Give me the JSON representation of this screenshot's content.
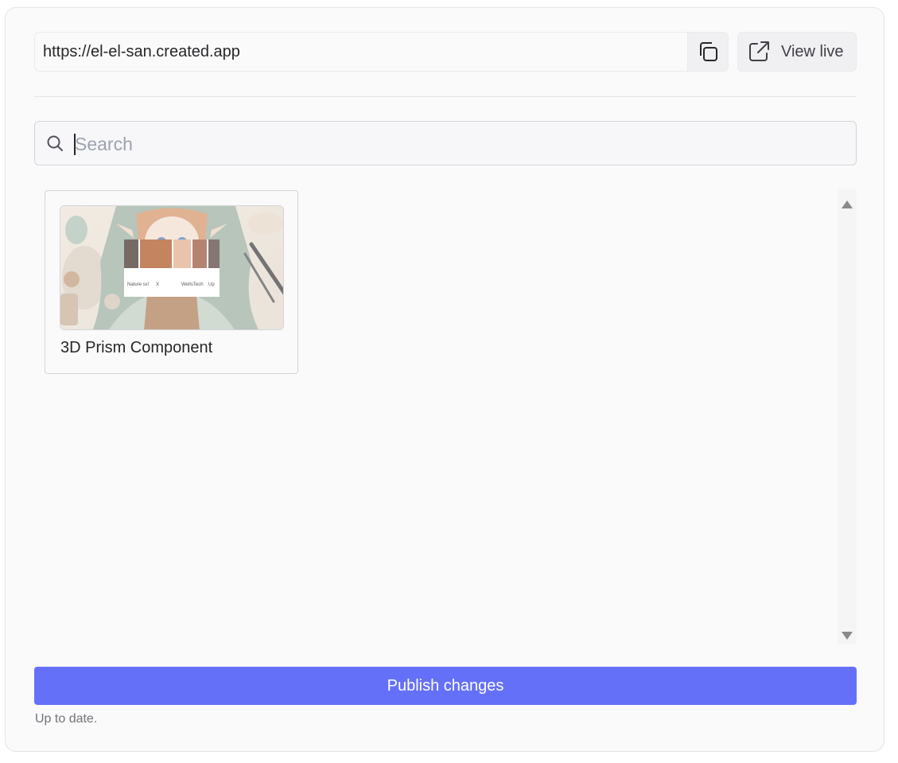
{
  "publish_panel": {
    "url": "https://el-el-san.created.app",
    "view_live_label": "View live",
    "search": {
      "placeholder": "Search",
      "value": ""
    },
    "components": [
      {
        "title": "3D Prism Component",
        "thumbnail": {
          "icon": "anime-illustration-preview",
          "captions": [
            "Nature sx!",
            "X",
            "WelIsTech",
            "Up"
          ]
        }
      }
    ],
    "publish_label": "Publish changes",
    "status": "Up to date.",
    "colors": {
      "accent": "#6570f8",
      "panel_bg": "#fafafa",
      "border": "#e4e4e7"
    }
  }
}
